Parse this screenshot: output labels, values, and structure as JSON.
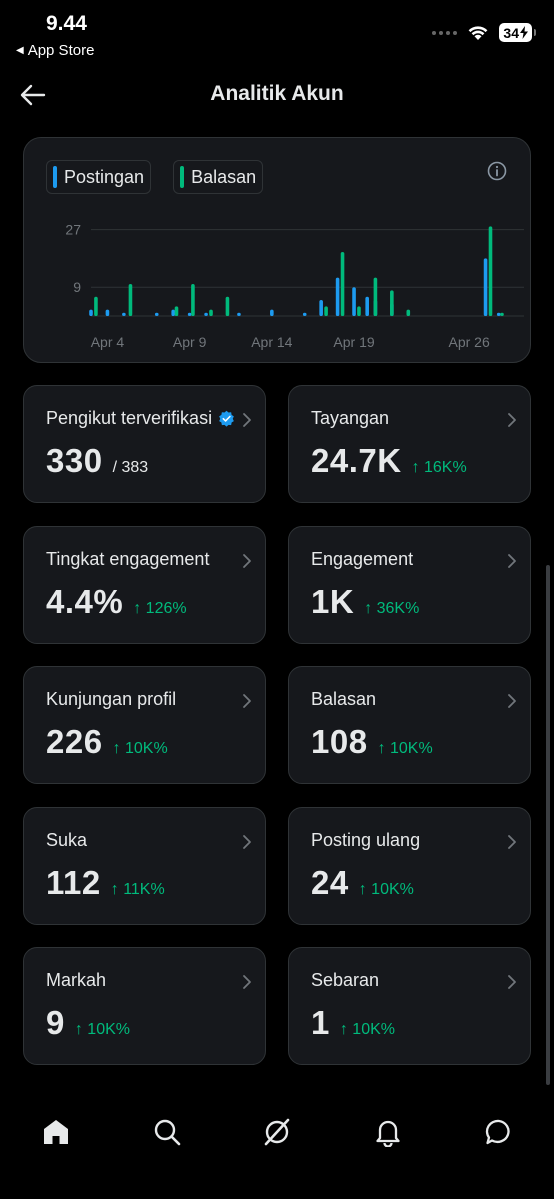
{
  "status_bar": {
    "time": "9.44",
    "back_app": "App Store",
    "battery": "34"
  },
  "header": {
    "title": "Analitik Akun"
  },
  "chart_data": {
    "type": "bar",
    "legend": [
      "Postingan",
      "Balasan"
    ],
    "colors": {
      "Postingan": "#1d9bf0",
      "Balasan": "#00ba7c"
    },
    "yticks": [
      27,
      9
    ],
    "ylim": [
      0,
      30
    ],
    "xticks": [
      "Apr 4",
      "Apr 9",
      "Apr 14",
      "Apr 19",
      "Apr 26"
    ],
    "xtick_days": [
      4,
      9,
      14,
      19,
      26
    ],
    "day_range": [
      3,
      28
    ],
    "series": [
      {
        "name": "Postingan",
        "values": [
          [
            3,
            2
          ],
          [
            4,
            2
          ],
          [
            5,
            1
          ],
          [
            7,
            1
          ],
          [
            8,
            2
          ],
          [
            9,
            1
          ],
          [
            10,
            1
          ],
          [
            12,
            1
          ],
          [
            14,
            2
          ],
          [
            16,
            1
          ],
          [
            17,
            5
          ],
          [
            18,
            12
          ],
          [
            19,
            9
          ],
          [
            19.8,
            6
          ],
          [
            20.3,
            5
          ],
          [
            21.3,
            4
          ],
          [
            27,
            18
          ],
          [
            27.8,
            1
          ]
        ]
      },
      {
        "name": "Balasan",
        "values": [
          [
            3.3,
            6
          ],
          [
            5.4,
            10
          ],
          [
            8.2,
            3
          ],
          [
            9.2,
            10
          ],
          [
            10.3,
            2
          ],
          [
            11.3,
            6
          ],
          [
            17.3,
            3
          ],
          [
            18.3,
            20
          ],
          [
            19.3,
            3
          ],
          [
            20.3,
            12
          ],
          [
            21.3,
            8
          ],
          [
            22.3,
            2
          ],
          [
            27.3,
            28
          ],
          [
            28,
            1
          ]
        ]
      }
    ]
  },
  "stats": [
    {
      "label": "Pengikut terverifikasi",
      "value": "330",
      "sub": "/ 383",
      "change": ""
    },
    {
      "label": "Tayangan",
      "value": "24.7K",
      "sub": "",
      "change": "↑ 16K%"
    },
    {
      "label": "Tingkat engagement",
      "value": "4.4%",
      "sub": "",
      "change": "↑ 126%"
    },
    {
      "label": "Engagement",
      "value": "1K",
      "sub": "",
      "change": "↑ 36K%"
    },
    {
      "label": "Kunjungan profil",
      "value": "226",
      "sub": "",
      "change": "↑ 10K%"
    },
    {
      "label": "Balasan",
      "value": "108",
      "sub": "",
      "change": "↑ 10K%"
    },
    {
      "label": "Suka",
      "value": "112",
      "sub": "",
      "change": "↑ 11K%"
    },
    {
      "label": "Posting ulang",
      "value": "24",
      "sub": "",
      "change": "↑ 10K%"
    },
    {
      "label": "Markah",
      "value": "9",
      "sub": "",
      "change": "↑ 10K%"
    },
    {
      "label": "Sebaran",
      "value": "1",
      "sub": "",
      "change": "↑ 10K%"
    }
  ],
  "tabs": [
    "home-icon",
    "search-icon",
    "grok-icon",
    "bell-icon",
    "message-icon"
  ]
}
